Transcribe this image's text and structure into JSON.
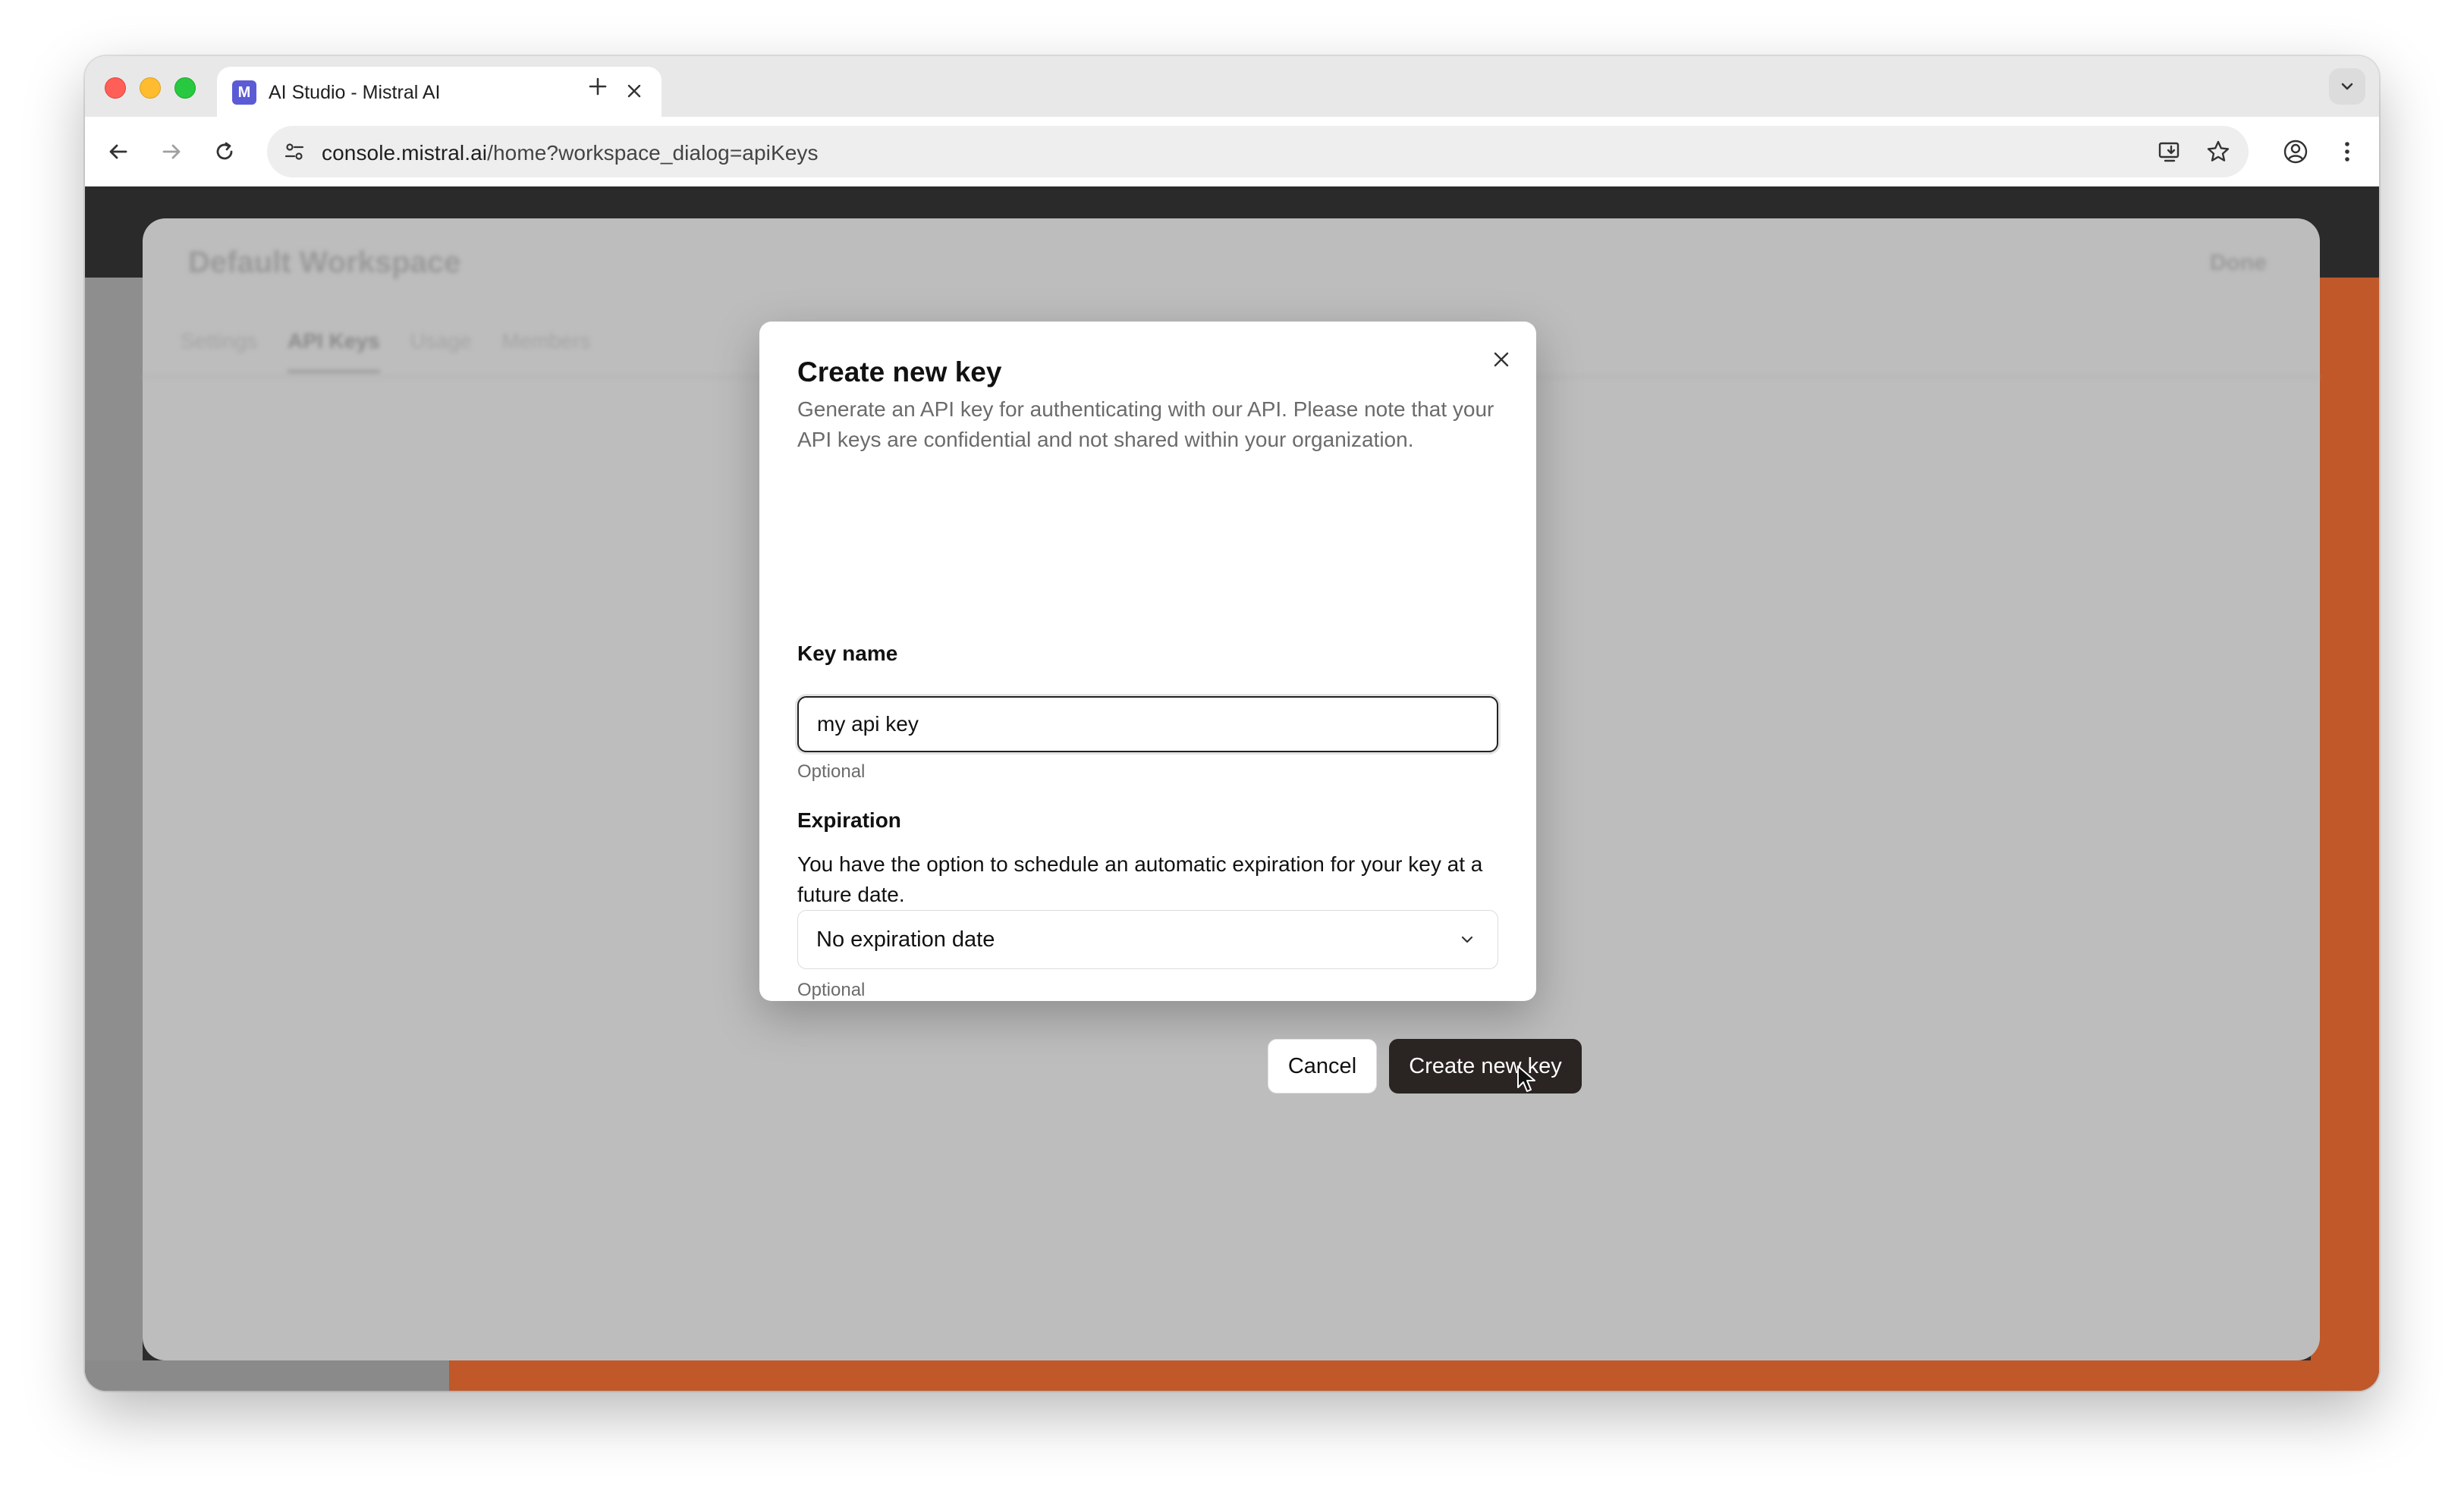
{
  "browser": {
    "tab": {
      "title": "AI Studio - Mistral AI",
      "favicon_icon": "mistral-logo-icon"
    },
    "address_bar": {
      "host": "console.mistral.ai",
      "path": "/home?workspace_dialog=apiKeys"
    }
  },
  "background_app": {
    "workspace_title": "Default Workspace",
    "done_label": "Done",
    "tabs": [
      "Settings",
      "API Keys",
      "Usage",
      "Members"
    ],
    "active_tab": "API Keys"
  },
  "dialog": {
    "title": "Create new key",
    "description": "Generate an API key for authenticating with our API. Please note that your API keys are confidential and not shared within your organization.",
    "key_name": {
      "label": "Key name",
      "value": "my api key",
      "helper": "Optional"
    },
    "expiration": {
      "label": "Expiration",
      "description": "You have the option to schedule an automatic expiration for your key at a future date.",
      "selected": "No expiration date",
      "helper": "Optional"
    },
    "buttons": {
      "cancel": "Cancel",
      "create": "Create new key"
    }
  },
  "colors": {
    "primary_button": "#2a2422",
    "accent_background": "#c0582a",
    "overlay": "#bdbdbd"
  }
}
